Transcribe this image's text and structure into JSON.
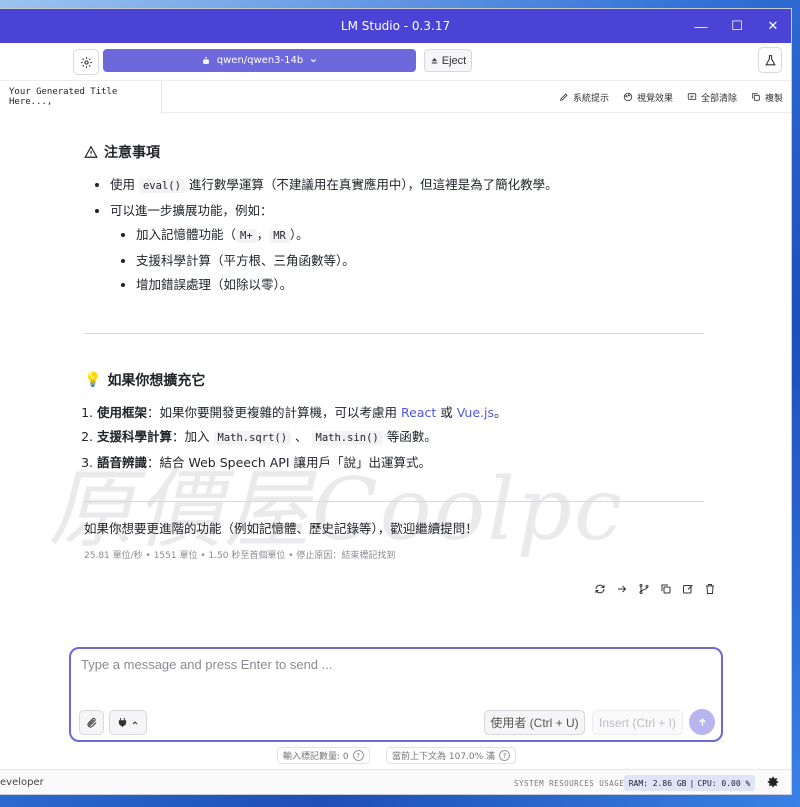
{
  "window": {
    "title": "LM Studio - 0.3.17",
    "controls": {
      "minimize": "—",
      "maximize": "☐",
      "close": "✕"
    }
  },
  "toolbar": {
    "model_name": "qwen/qwen3-14b",
    "eject_label": "Eject"
  },
  "tabs": {
    "active_title": "Your Generated Title Here...,",
    "actions": [
      {
        "label": "系統提示",
        "icon": "system-prompt-icon"
      },
      {
        "label": "視覺效果",
        "icon": "palette-icon"
      },
      {
        "label": "全部清除",
        "icon": "clear-all-icon"
      },
      {
        "label": "複製",
        "icon": "copy-icon"
      }
    ]
  },
  "message": {
    "section1_heading": "注意事項",
    "section1_items": [
      {
        "pre": "使用 ",
        "code": "eval()",
        "post": " 進行數學運算（不建議用在真實應用中），但這裡是為了簡化教學。"
      },
      {
        "pre": "可以進一步擴展功能，例如：",
        "code": "",
        "post": ""
      }
    ],
    "section1_subitems": [
      {
        "pre": "加入記憶體功能（",
        "code1": "M+",
        "mid": "，",
        "code2": "MR",
        "post": "）。"
      },
      {
        "pre": "支援科學計算（平方根、三角函數等）。"
      },
      {
        "pre": "增加錯誤處理（如除以零）。"
      }
    ],
    "section2_heading": "如果你想擴充它",
    "section2_items": [
      {
        "bold": "使用框架",
        "text": "：如果你要開發更複雜的計算機，可以考慮用 ",
        "link1": "React",
        "or": " 或 ",
        "link2": "Vue.js",
        "end": "。"
      },
      {
        "bold": "支援科學計算",
        "text": "：加入 ",
        "code1": "Math.sqrt()",
        "sep": " 、 ",
        "code2": "Math.sin()",
        "end": " 等函數。"
      },
      {
        "bold": "語音辨識",
        "text": "：結合 Web Speech API 讓用戶「說」出運算式。"
      }
    ],
    "closing": "如果你想要更進階的功能（例如記憶體、歷史記錄等），歡迎繼續提問！",
    "stats": "25.81 單位/秒 • 1551 單位 • 1.50 秒至首個單位 • 停止原因：結束標記找到"
  },
  "watermark": "原價屋Coolpc",
  "composer": {
    "placeholder": "Type a message and press Enter to send ...",
    "role_label": "使用者 (Ctrl + U)",
    "insert_label": "Insert (Ctrl + I)"
  },
  "counters": {
    "input_tokens": "輸入標記數量:  0",
    "context_usage": "當前上下文為 107.0% 滿"
  },
  "status": {
    "mode": "eveloper",
    "resources_label": "SYSTEM RESOURCES USAGE:",
    "ram": "RAM: 2.86 GB",
    "cpu": "CPU: 0.00 %"
  },
  "colors": {
    "accent": "#4a43d6",
    "model_button": "#6d68dc",
    "link": "#4e5ad8"
  }
}
